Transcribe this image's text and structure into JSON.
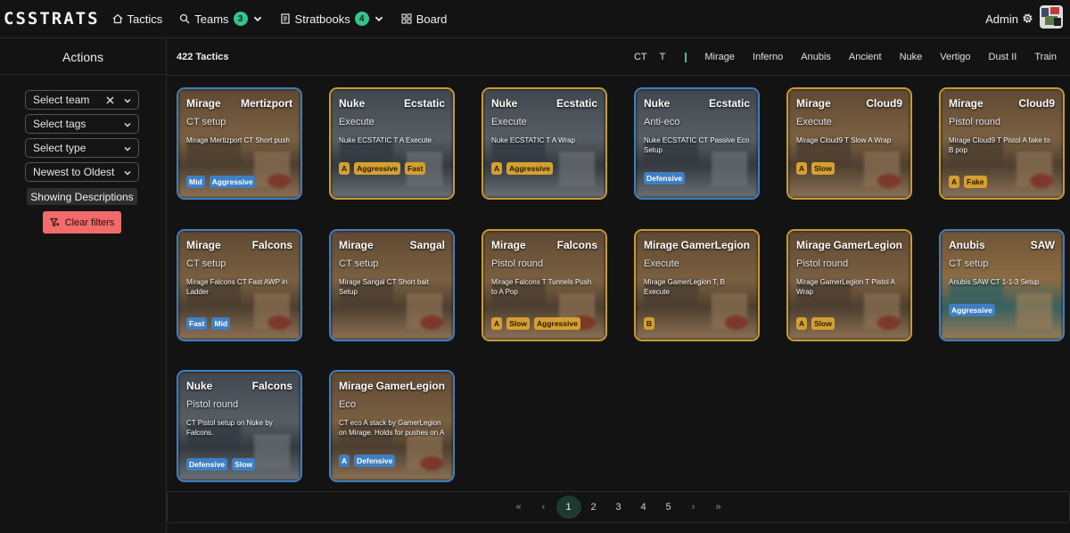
{
  "app": {
    "logo": "CSSTRATS",
    "nav": [
      {
        "label": "Tactics",
        "icon": "home-icon"
      },
      {
        "label": "Teams",
        "icon": "search-icon",
        "badge": "3"
      },
      {
        "label": "Stratbooks",
        "icon": "book-icon",
        "badge": "4"
      },
      {
        "label": "Board",
        "icon": "grid-icon"
      }
    ],
    "user": "Admin"
  },
  "sidebar": {
    "title": "Actions",
    "filters": {
      "team": "Select team",
      "tags": "Select tags",
      "type": "Select type",
      "sort": "Newest to Oldest"
    },
    "descriptions_button": "Showing Descriptions",
    "clear_button": "Clear filters"
  },
  "header": {
    "count": "422 Tactics",
    "sides": [
      "CT",
      "T"
    ],
    "maps": [
      "Mirage",
      "Inferno",
      "Anubis",
      "Ancient",
      "Nuke",
      "Vertigo",
      "Dust II",
      "Train"
    ]
  },
  "tactics": [
    {
      "map": "Mirage",
      "team": "Mertizport",
      "type": "CT setup",
      "description": "Mirage Mertizport CT Short push",
      "side": "ct",
      "tags": [
        "Mid",
        "Aggressive"
      ]
    },
    {
      "map": "Nuke",
      "team": "Ecstatic",
      "type": "Execute",
      "description": "Nuke ECSTATIC T A Execute",
      "side": "t",
      "tags": [
        "A",
        "Aggressive",
        "Fast"
      ]
    },
    {
      "map": "Nuke",
      "team": "Ecstatic",
      "type": "Execute",
      "description": "Nuke ECSTATIC T A Wrap",
      "side": "t",
      "tags": [
        "A",
        "Aggressive"
      ]
    },
    {
      "map": "Nuke",
      "team": "Ecstatic",
      "type": "Anti-eco",
      "description": "Nuke ECSTATIC CT Passive Eco Setup",
      "side": "ct",
      "tags": [
        "Defensive"
      ]
    },
    {
      "map": "Mirage",
      "team": "Cloud9",
      "type": "Execute",
      "description": "Mirage Cloud9 T Slow A Wrap",
      "side": "t",
      "tags": [
        "A",
        "Slow"
      ]
    },
    {
      "map": "Mirage",
      "team": "Cloud9",
      "type": "Pistol round",
      "description": "Mirage Cloud9 T Pistol A fake to B pop",
      "side": "t",
      "tags": [
        "A",
        "Fake"
      ]
    },
    {
      "map": "Mirage",
      "team": "Falcons",
      "type": "CT setup",
      "description": "Mirage Falcons CT Fast AWP in Ladder",
      "side": "ct",
      "tags": [
        "Fast",
        "Mid"
      ]
    },
    {
      "map": "Mirage",
      "team": "Sangal",
      "type": "CT setup",
      "description": "Mirage Sangal CT Short bait Setup",
      "side": "ct",
      "tags": []
    },
    {
      "map": "Mirage",
      "team": "Falcons",
      "type": "Pistol round",
      "description": "Mirage Falcons T Tunnels Push to A Pop",
      "side": "t",
      "tags": [
        "A",
        "Slow",
        "Aggressive"
      ]
    },
    {
      "map": "Mirage",
      "team": "GamerLegion",
      "type": "Execute",
      "description": "Mirage GamerLegion T, B Execute",
      "side": "t",
      "tags": [
        "B"
      ]
    },
    {
      "map": "Mirage",
      "team": "GamerLegion",
      "type": "Pistol round",
      "description": "Mirage GamerLegion T Pistol A Wrap",
      "side": "t",
      "tags": [
        "A",
        "Slow"
      ]
    },
    {
      "map": "Anubis",
      "team": "SAW",
      "type": "CT setup",
      "description": "Anubis SAW CT 1-1-3 Setup",
      "side": "ct",
      "tags": [
        "Aggressive"
      ]
    },
    {
      "map": "Nuke",
      "team": "Falcons",
      "type": "Pistol round",
      "description": "CT Pistol setup on Nuke by Falcons.",
      "side": "ct",
      "tags": [
        "Defensive",
        "Slow"
      ]
    },
    {
      "map": "Mirage",
      "team": "GamerLegion",
      "type": "Eco",
      "description": "CT eco A stack by GamerLegion on Mirage. Holds for pushes on A at start and then retakes Mid wh...",
      "side": "ct",
      "tags": [
        "A",
        "Defensive"
      ]
    }
  ],
  "pagination": {
    "first": "«",
    "prev": "‹",
    "pages": [
      "1",
      "2",
      "3",
      "4",
      "5"
    ],
    "current": "1",
    "next": "›",
    "last": "»"
  },
  "colors": {
    "t_side": "#c99b2e",
    "ct_side": "#3f7fc2",
    "accent": "#34c48a",
    "danger": "#f26b6b"
  }
}
